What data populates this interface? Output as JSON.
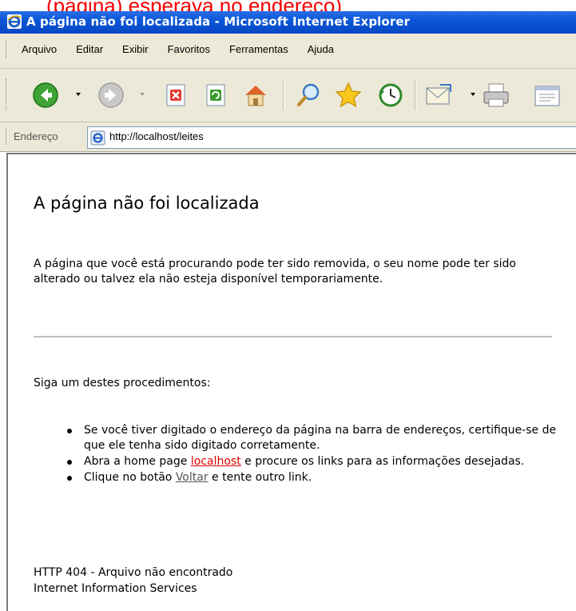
{
  "window": {
    "clipped_top_text": "(página) esperava no endereço)",
    "title": "A página não foi localizada - Microsoft Internet Explorer"
  },
  "menu": [
    "Arquivo",
    "Editar",
    "Exibir",
    "Favoritos",
    "Ferramentas",
    "Ajuda"
  ],
  "address": {
    "label": "Endereço",
    "url": "http://localhost/leites"
  },
  "page": {
    "heading": "A página não foi localizada",
    "intro": "A página que você está procurando pode ter sido removida, o seu nome pode ter sido alterado ou talvez ela não esteja disponível temporariamente.",
    "instructions": "Siga um destes procedimentos:",
    "bullet1": "Se você tiver digitado o endereço da página na barra de endereços, certifique-se de que ele tenha sido digitado corretamente.",
    "bullet2_pre": "Abra a home page ",
    "bullet2_link": "localhost",
    "bullet2_post": " e procure os links para as informações desejadas.",
    "bullet3_pre": "Clique no botão ",
    "bullet3_link": "Voltar",
    "bullet3_post": " e tente outro link.",
    "footer_line1": "HTTP 404 - Arquivo não encontrado",
    "footer_line2": "Internet Information Services"
  },
  "toolbar_icons": [
    "back-icon",
    "forward-icon",
    "stop-icon",
    "refresh-icon",
    "home-icon",
    "search-icon",
    "favorites-icon",
    "history-icon",
    "mail-icon",
    "print-icon",
    "edit-icon"
  ]
}
